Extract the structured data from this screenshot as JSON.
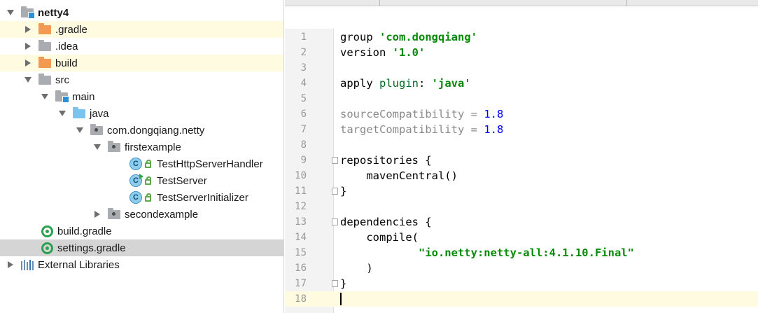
{
  "project_tree": {
    "root": {
      "label": "netty4"
    },
    "items": [
      {
        "label": ".gradle"
      },
      {
        "label": ".idea"
      },
      {
        "label": "build"
      },
      {
        "label": "src"
      },
      {
        "label": "main"
      },
      {
        "label": "java"
      },
      {
        "label": "com.dongqiang.netty"
      },
      {
        "label": "firstexample"
      },
      {
        "label": "TestHttpServerHandler"
      },
      {
        "label": "TestServer"
      },
      {
        "label": "TestServerInitializer"
      },
      {
        "label": "secondexample"
      },
      {
        "label": "build.gradle"
      },
      {
        "label": "settings.gradle"
      },
      {
        "label": "External Libraries"
      }
    ],
    "class_icon_letter": "C"
  },
  "editor": {
    "lines": [
      {
        "n": "1"
      },
      {
        "n": "2"
      },
      {
        "n": "3"
      },
      {
        "n": "4"
      },
      {
        "n": "5"
      },
      {
        "n": "6"
      },
      {
        "n": "7"
      },
      {
        "n": "8"
      },
      {
        "n": "9"
      },
      {
        "n": "10"
      },
      {
        "n": "11"
      },
      {
        "n": "12"
      },
      {
        "n": "13"
      },
      {
        "n": "14"
      },
      {
        "n": "15"
      },
      {
        "n": "16"
      },
      {
        "n": "17"
      },
      {
        "n": "18"
      }
    ],
    "code": {
      "group_kw": "group ",
      "group_val": "'com.dongqiang'",
      "version_kw": "version ",
      "version_val": "'1.0'",
      "apply_kw": "apply ",
      "plugin_kw": "plugin",
      "colon": ": ",
      "plugin_val": "'java'",
      "source_kw": "sourceCompatibility",
      "target_kw": "targetCompatibility",
      "eq": " = ",
      "source_val": "1.8",
      "target_val": "1.8",
      "repos_open": "repositories {",
      "maven": "    mavenCentral()",
      "close_brace": "}",
      "deps_open": "dependencies {",
      "compile_open": "    compile(",
      "indent": "            ",
      "netty_dep": "\"io.netty:netty-all:4.1.10.Final\"",
      "compile_close": "    )"
    }
  },
  "colors": {
    "string": "#068a06",
    "number": "#0000ff",
    "row_highlight": "#fefbe0",
    "selected_row": "#d5d5d5"
  }
}
